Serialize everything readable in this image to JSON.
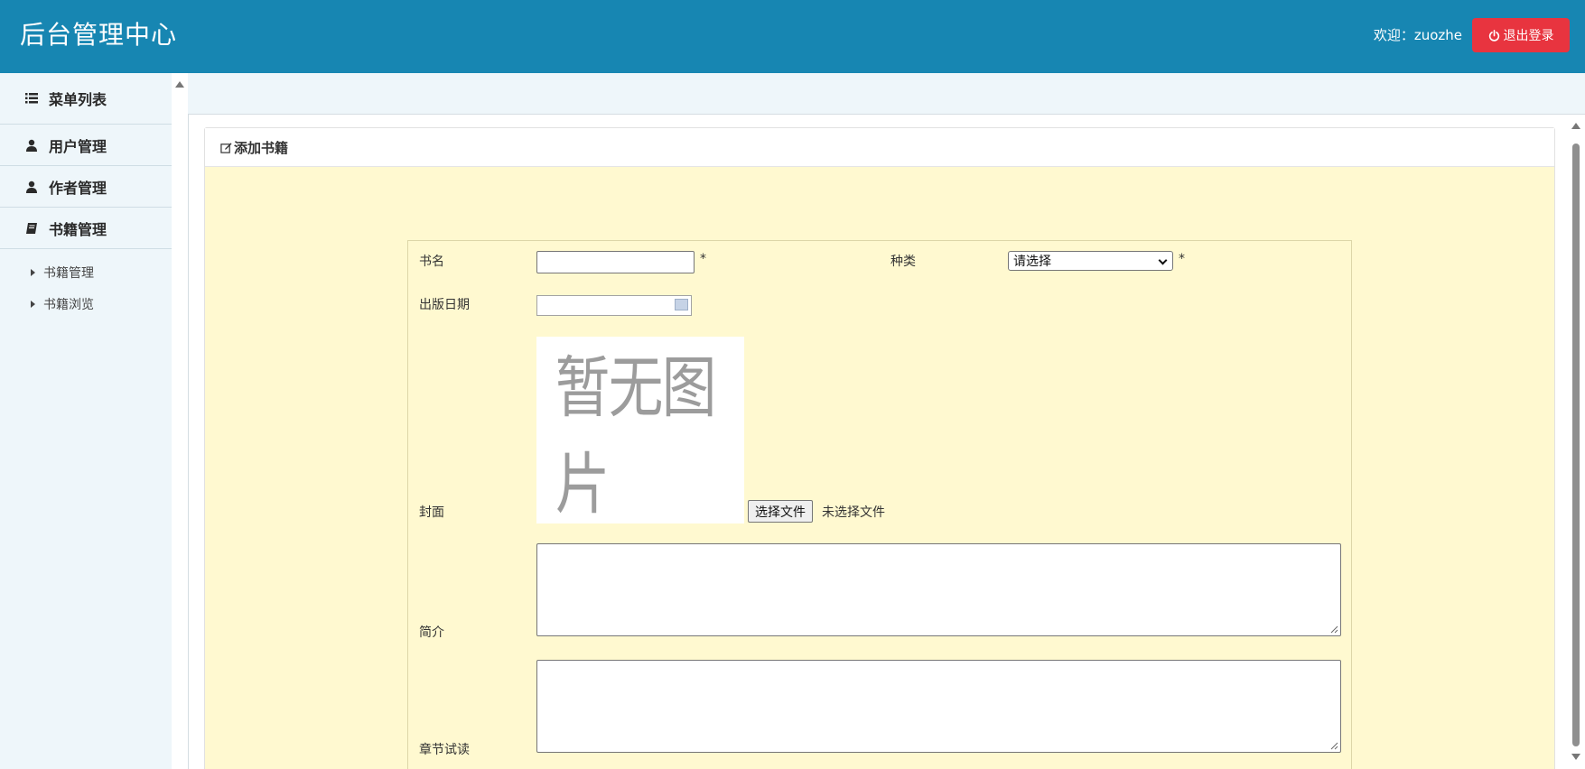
{
  "header": {
    "title": "后台管理中心",
    "welcome": "欢迎：zuozhe",
    "logout_label": "退出登录"
  },
  "sidebar": {
    "heading": "菜单列表",
    "items": [
      {
        "label": "用户管理",
        "icon": "user-icon"
      },
      {
        "label": "作者管理",
        "icon": "user-icon"
      },
      {
        "label": "书籍管理",
        "icon": "book-icon"
      }
    ],
    "sub_items": [
      {
        "label": "书籍管理"
      },
      {
        "label": "书籍浏览"
      }
    ]
  },
  "panel": {
    "title": "添加书籍"
  },
  "form": {
    "name_label": "书名",
    "name_value": "",
    "required_mark": "*",
    "category_label": "种类",
    "category_selected": "请选择",
    "date_label": "出版日期",
    "date_value": "",
    "cover_label": "封面",
    "cover_placeholder": "暂无图片",
    "file_button": "选择文件",
    "file_status": "未选择文件",
    "intro_label": "简介",
    "intro_value": "",
    "chapter_label": "章节试读",
    "chapter_value": ""
  },
  "colors": {
    "header_bg": "#1786b2",
    "logout_bg": "#e8343f",
    "form_bg": "#fff9d0",
    "sidebar_bg": "#eef6fa"
  }
}
